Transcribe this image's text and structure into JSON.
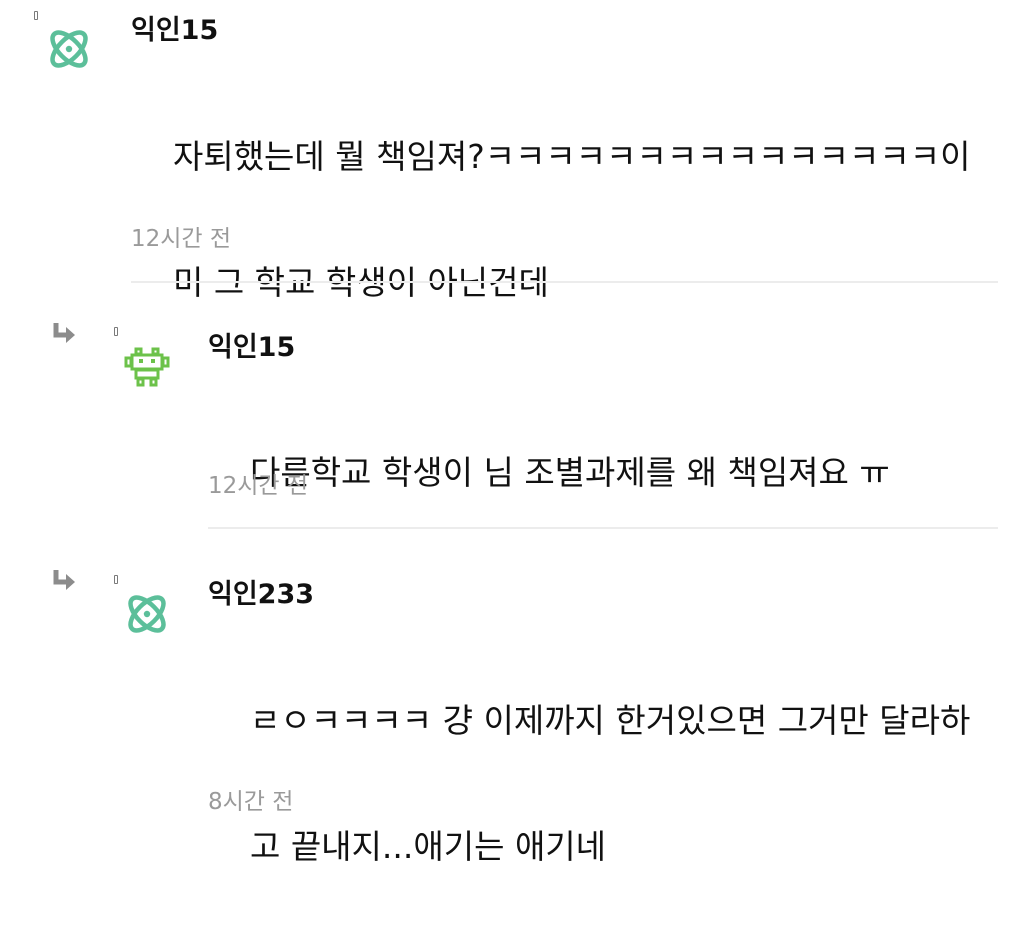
{
  "comments": [
    {
      "username": "익인15",
      "avatar": "atom-icon",
      "avatar_color": "#5cbf9a",
      "text_lines": [
        "자퇴했는데 뭘 책임져?ㅋㅋㅋㅋㅋㅋㅋㅋㅋㅋㅋㅋㅋㅋㅋ이",
        "미 그 학교 학생이 아닌건데"
      ],
      "timestamp": "12시간 전",
      "is_reply": false
    },
    {
      "username": "익인15",
      "avatar": "space-invader-icon",
      "avatar_color": "#6cc24a",
      "text_lines": [
        "다른학교 학생이 님 조별과제를 왜 책임져요 ㅠ"
      ],
      "timestamp": "12시간 전",
      "is_reply": true
    },
    {
      "username": "익인233",
      "avatar": "atom-icon",
      "avatar_color": "#5cbf9a",
      "text_lines": [
        "ㄹㅇㅋㅋㅋㅋ 걍 이제까지 한거있으면 그거만 달라하",
        "고 끝내지...애기는 애기네"
      ],
      "timestamp": "8시간 전",
      "is_reply": true
    }
  ]
}
